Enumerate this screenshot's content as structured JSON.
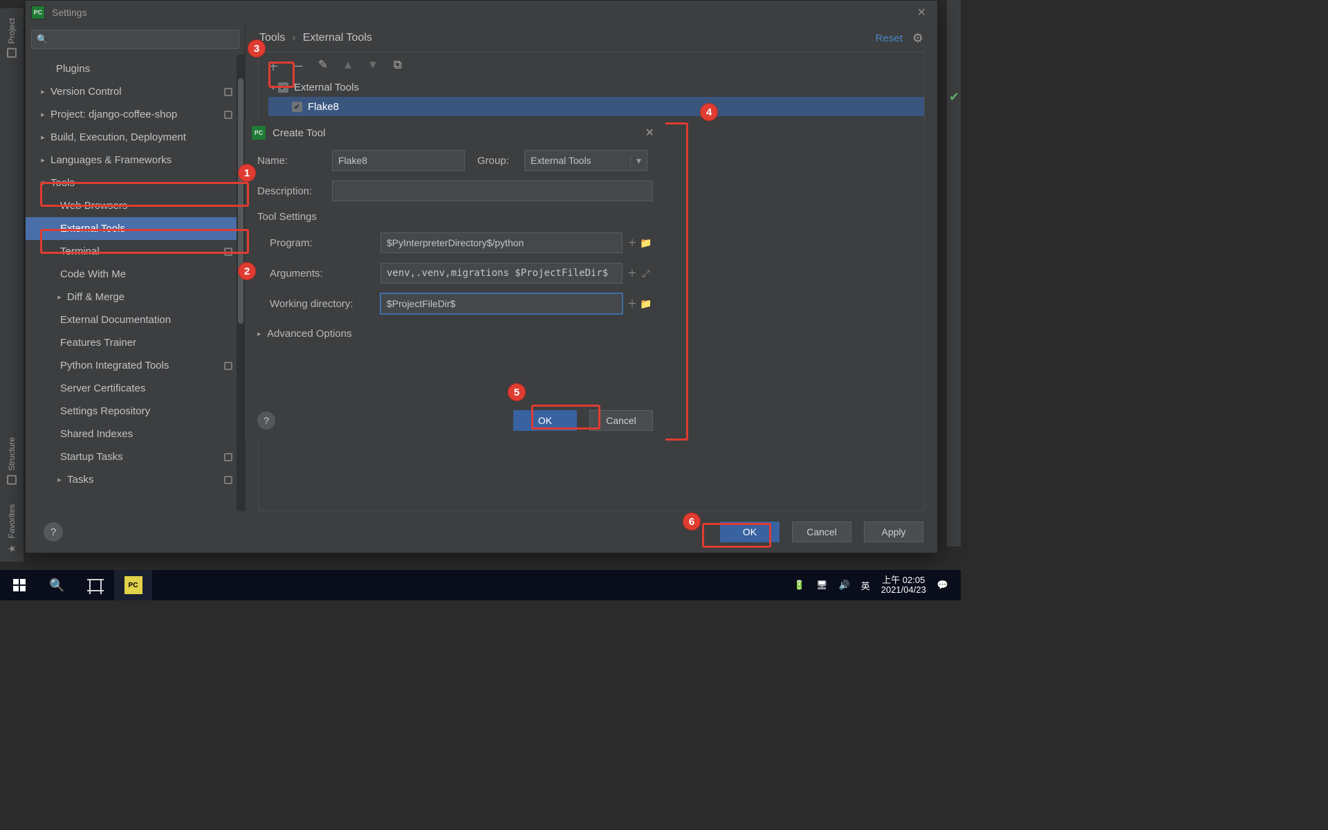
{
  "titlebar": {
    "title": "Settings"
  },
  "sidebar": {
    "search_placeholder": "",
    "plugins": "Plugins",
    "version_control": "Version Control",
    "project": "Project: django-coffee-shop",
    "build": "Build, Execution, Deployment",
    "langfw": "Languages & Frameworks",
    "tools": "Tools",
    "tools_children": {
      "web_browsers": "Web Browsers",
      "external_tools": "External Tools",
      "terminal": "Terminal",
      "code_with_me": "Code With Me",
      "diff_merge": "Diff & Merge",
      "external_doc": "External Documentation",
      "features_trainer": "Features Trainer",
      "python_integrated": "Python Integrated Tools",
      "server_certs": "Server Certificates",
      "settings_repo": "Settings Repository",
      "shared_indexes": "Shared Indexes",
      "startup_tasks": "Startup Tasks",
      "tasks": "Tasks"
    }
  },
  "breadcrumb": {
    "root": "Tools",
    "leaf": "External Tools",
    "reset": "Reset"
  },
  "tool_tree": {
    "group": "External Tools",
    "item1": "Flake8"
  },
  "dialog": {
    "title": "Create Tool",
    "name_label": "Name:",
    "name_value": "Flake8",
    "group_label": "Group:",
    "group_value": "External Tools",
    "desc_label": "Description:",
    "desc_value": "",
    "section": "Tool Settings",
    "program_label": "Program:",
    "program_value": "$PyInterpreterDirectory$/python",
    "arguments_label": "Arguments:",
    "arguments_value": "venv,.venv,migrations $ProjectFileDir$",
    "workdir_label": "Working directory:",
    "workdir_value": "$ProjectFileDir$",
    "advanced": "Advanced Options",
    "ok": "OK",
    "cancel": "Cancel"
  },
  "footer": {
    "ok": "OK",
    "cancel": "Cancel",
    "apply": "Apply"
  },
  "rails": {
    "project": "Project",
    "structure": "Structure",
    "favorites": "Favorites"
  },
  "taskbar": {
    "ime": "英",
    "time": "上午 02:05",
    "date": "2021/04/23"
  },
  "annotations": {
    "a1": "1",
    "a2": "2",
    "a3": "3",
    "a4": "4",
    "a5": "5",
    "a6": "6"
  }
}
